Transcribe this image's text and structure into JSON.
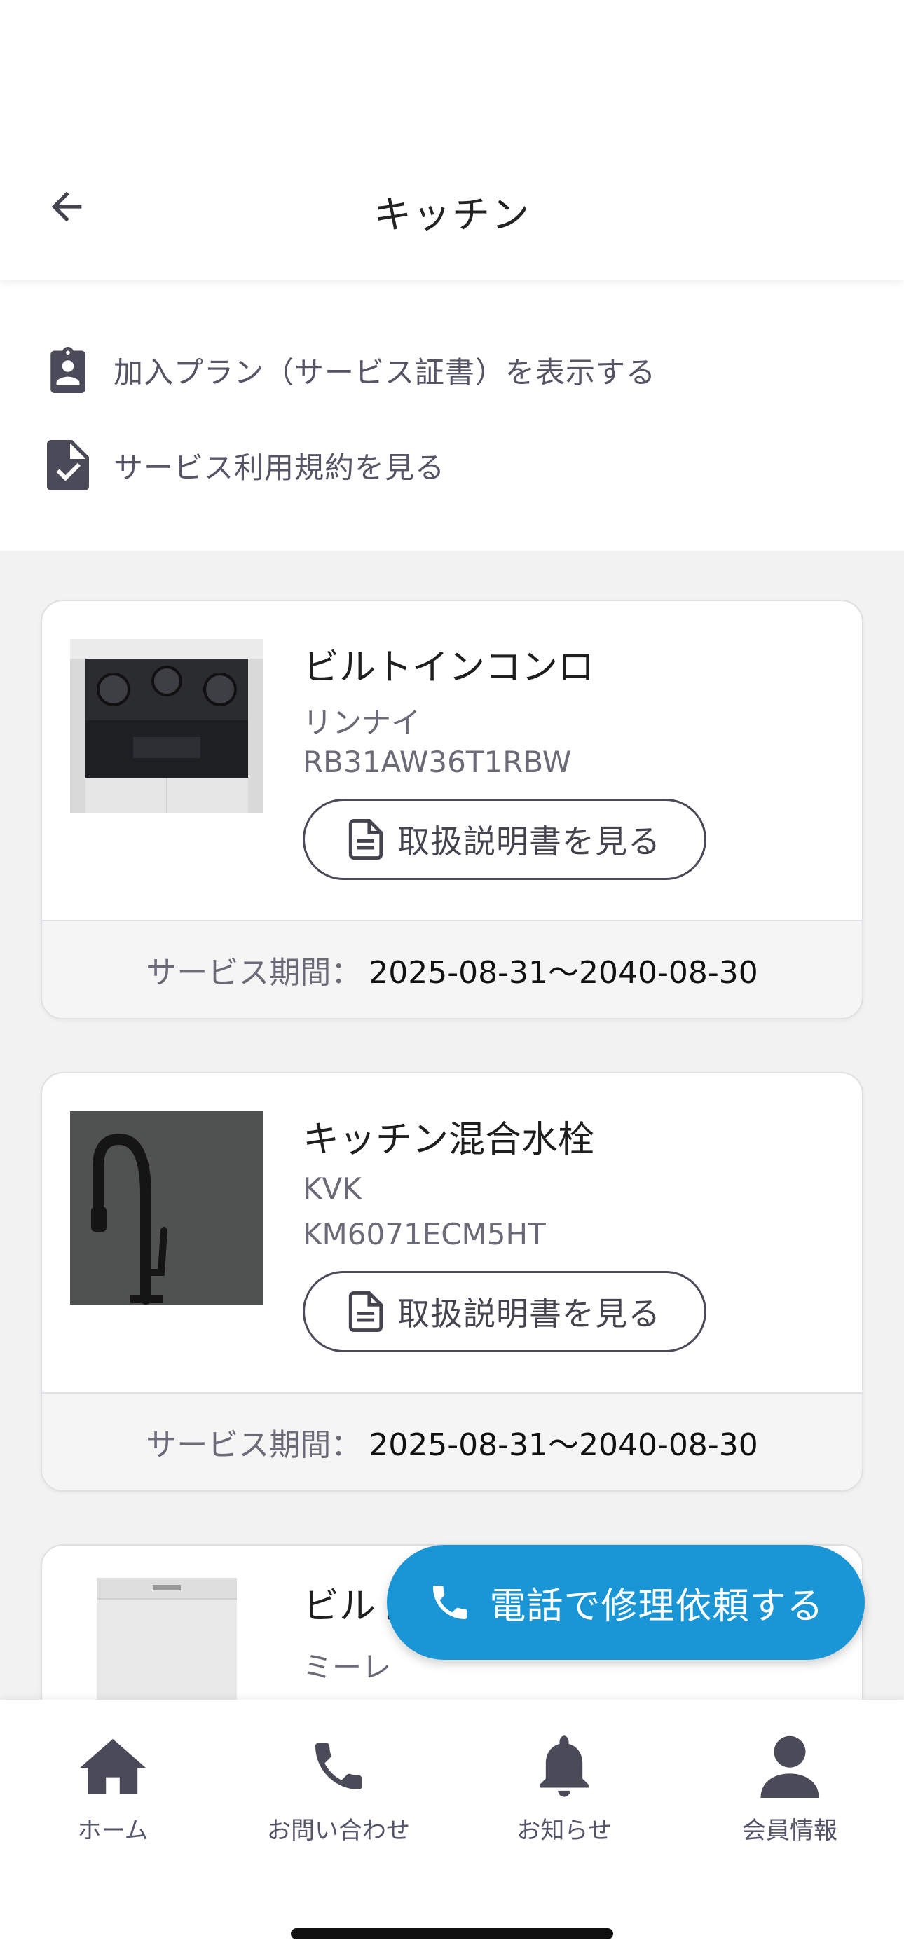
{
  "header": {
    "title": "キッチン"
  },
  "links": [
    {
      "label": "加入プラン（サービス証書）を表示する",
      "icon": "clipboard-account-icon"
    },
    {
      "label": "サービス利用規約を見る",
      "icon": "file-check-icon"
    }
  ],
  "products": [
    {
      "name": "ビルトインコンロ",
      "maker": "リンナイ",
      "model": "RB31AW36T1RBW",
      "manual_label": "取扱説明書を見る",
      "period_label": "サービス期間：",
      "period_value": "2025-08-31〜2040-08-30"
    },
    {
      "name": "キッチン混合水栓",
      "maker": "KVK",
      "model": "KM6071ECM5HT",
      "manual_label": "取扱説明書を見る",
      "period_label": "サービス期間：",
      "period_value": "2025-08-31〜2040-08-30"
    },
    {
      "name": "ビルトイン食器洗い乾燥機",
      "maker": "ミーレ",
      "model": ""
    }
  ],
  "fab": {
    "label": "電話で修理依頼する",
    "color": "#1a96d6"
  },
  "tabbar": {
    "items": [
      {
        "label": "ホーム",
        "icon": "home-icon"
      },
      {
        "label": "お問い合わせ",
        "icon": "phone-icon"
      },
      {
        "label": "お知らせ",
        "icon": "bell-icon"
      },
      {
        "label": "会員情報",
        "icon": "account-icon"
      }
    ]
  }
}
